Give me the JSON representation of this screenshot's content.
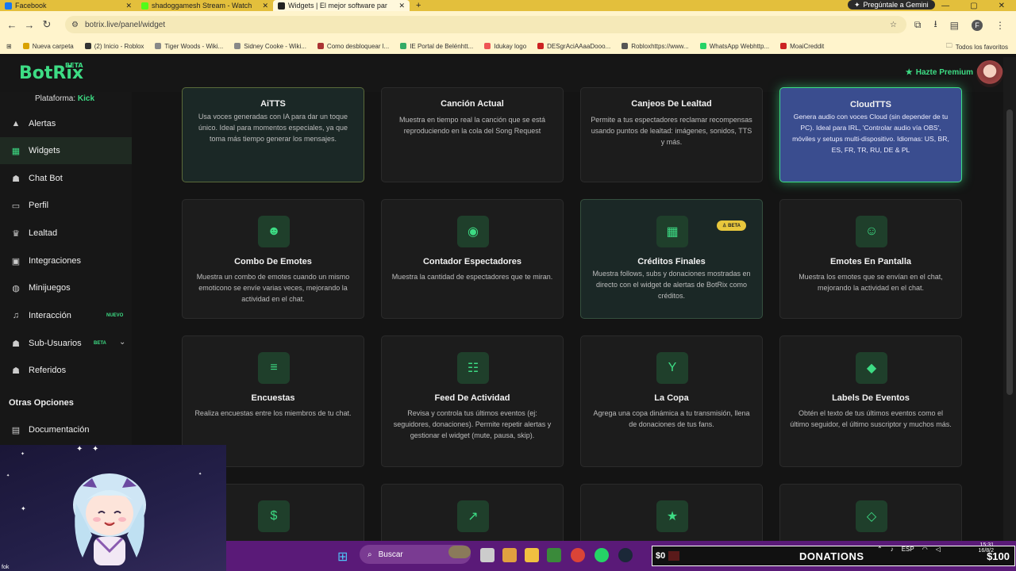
{
  "browser": {
    "tabs": [
      {
        "title": "Facebook",
        "color": "#1877f2",
        "active": false
      },
      {
        "title": "shadoggamesh Stream - Watch",
        "color": "#53fc18",
        "active": false
      },
      {
        "title": "Widgets | El mejor software par",
        "color": "#222222",
        "active": true
      }
    ],
    "new_tab": "+",
    "gemini": "Pregúntale a Gemini",
    "url": "botrix.live/panel/widget",
    "profile": "F",
    "bookmarks": [
      "Nueva carpeta",
      "(2) Inicio - Roblox",
      "Tiger Woods - Wiki...",
      "Sidney Cooke - Wiki...",
      "Como desbloquear l...",
      "IE Portal de Belénhtt...",
      "Idukay logo",
      "DESgrAciAAaaDooo...",
      "Robloxhttps://www...",
      "WhatsApp Webhttp...",
      "MoaiCreddit"
    ],
    "bookmarks_right": "Todos los favoritos"
  },
  "header": {
    "logo": "BotRix",
    "logo_badge": "BETA",
    "premium": "Hazte Premium"
  },
  "sidebar": {
    "platform_label": "Plataforma:",
    "platform_value": "Kick",
    "items": [
      {
        "label": "Alertas",
        "icon": "warning-icon"
      },
      {
        "label": "Widgets",
        "icon": "widgets-icon"
      },
      {
        "label": "Chat Bot",
        "icon": "robot-icon"
      },
      {
        "label": "Perfil",
        "icon": "id-card-icon"
      },
      {
        "label": "Lealtad",
        "icon": "trophy-icon"
      },
      {
        "label": "Integraciones",
        "icon": "integrations-icon"
      },
      {
        "label": "Minijuegos",
        "icon": "gamepad-icon"
      },
      {
        "label": "Interacción",
        "icon": "music-icon"
      },
      {
        "label": "Sub-Usuarios",
        "icon": "users-icon"
      },
      {
        "label": "Referidos",
        "icon": "referral-icon"
      }
    ],
    "badge_nuevo": "NUEVO",
    "badge_beta": "BETA",
    "other_heading": "Otras Opciones",
    "docs": "Documentación"
  },
  "widgets": [
    {
      "title": "AiTTS",
      "desc": "Usa voces generadas con IA para dar un toque único. Ideal para momentos especiales, ya que toma más tiempo generar los mensajes.",
      "icon": ""
    },
    {
      "title": "Canción Actual",
      "desc": "Muestra en tiempo real la canción que se está reproduciendo en la cola del Song Request",
      "icon": ""
    },
    {
      "title": "Canjeos De Lealtad",
      "desc": "Permite a tus espectadores reclamar recompensas usando puntos de lealtad: imágenes, sonidos, TTS y más.",
      "icon": ""
    },
    {
      "title": "CloudTTS",
      "desc": "Genera audio con voces Cloud (sin depender de tu PC). Ideal para IRL, 'Controlar audio vía OBS', móviles y setups multi-dispositivo. Idiomas: US, BR, ES, FR, TR, RU, DE & PL",
      "icon": ""
    },
    {
      "title": "Combo De Emotes",
      "desc": "Muestra un combo de emotes cuando un mismo emoticono se envíe varias veces, mejorando la actividad en el chat.",
      "icon": "☻"
    },
    {
      "title": "Contador Espectadores",
      "desc": "Muestra la cantidad de espectadores que te miran.",
      "icon": "◉"
    },
    {
      "title": "Créditos Finales",
      "desc": "Muestra follows, subs y donaciones mostradas en directo con el widget de alertas de BotRix como créditos.",
      "icon": "▦",
      "badge": "BETA"
    },
    {
      "title": "Emotes En Pantalla",
      "desc": "Muestra los emotes que se envían en el chat, mejorando la actividad en el chat.",
      "icon": "☺"
    },
    {
      "title": "Encuestas",
      "desc": "Realiza encuestas entre los miembros de tu chat.",
      "icon": "≡"
    },
    {
      "title": "Feed De Actividad",
      "desc": "Revisa y controla tus últimos eventos (ej: seguidores, donaciones). Permite repetir alertas y gestionar el widget (mute, pausa, skip).",
      "icon": "☷"
    },
    {
      "title": "La Copa",
      "desc": "Agrega una copa dinámica a tu transmisión, llena de donaciones de tus fans.",
      "icon": "Y"
    },
    {
      "title": "Labels De Eventos",
      "desc": "Obtén el texto de tus últimos eventos como el último seguidor, el último suscriptor y muchos más.",
      "icon": "◆"
    },
    {
      "title": "",
      "desc": "",
      "icon": "$"
    },
    {
      "title": "",
      "desc": "",
      "icon": "↗"
    },
    {
      "title": "",
      "desc": "",
      "icon": "★"
    },
    {
      "title": "",
      "desc": "",
      "icon": "◇"
    }
  ],
  "taskbar": {
    "search": "Buscar",
    "donations_left": "$0",
    "donations_label": "DONATIONS",
    "donations_right": "$100",
    "lang": "ESP",
    "time": "15:31",
    "date": "16/8/2"
  },
  "overlay_text": "fok"
}
